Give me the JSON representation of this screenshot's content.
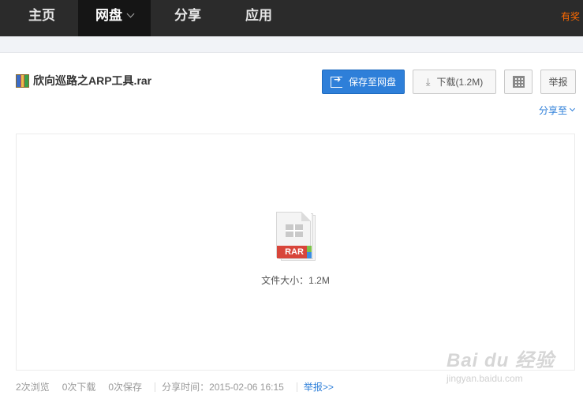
{
  "nav": {
    "items": [
      {
        "label": "主页"
      },
      {
        "label": "网盘"
      },
      {
        "label": "分享"
      },
      {
        "label": "应用"
      }
    ],
    "promo": "有奖"
  },
  "file": {
    "title": "欣向巡路之ARP工具.rar",
    "type_badge": "RAR",
    "size_text": "文件大小：1.2M"
  },
  "toolbar": {
    "save_label": "保存至网盘",
    "download_label": "下载(1.2M)",
    "report_label": "举报",
    "share_to_label": "分享至"
  },
  "stats": {
    "views": "2次浏览",
    "downloads": "0次下载",
    "saves": "0次保存",
    "share_time": "分享时间：2015-02-06 16:15",
    "report_link": "举报>>"
  },
  "watermark": {
    "brand": "Bai du 经验",
    "url": "jingyan.baidu.com"
  },
  "colors": {
    "nav_bg": "#2b2b2b",
    "accent": "#2e7fd9",
    "promo": "#ff6a00",
    "rar_red": "#d8453a"
  }
}
